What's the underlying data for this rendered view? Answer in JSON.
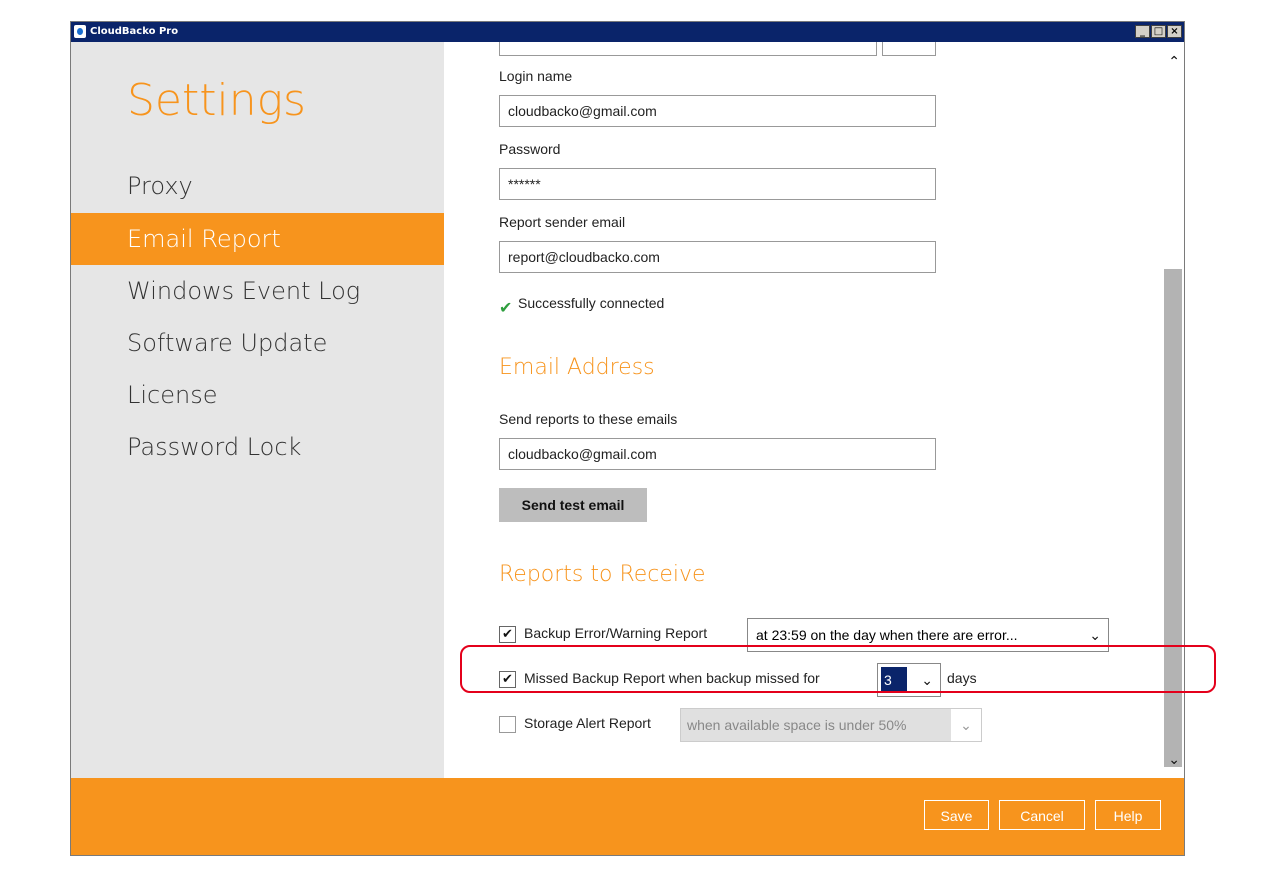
{
  "window": {
    "title": "CloudBacko Pro",
    "minimize": "_",
    "maximize": "□",
    "close": "×"
  },
  "sidebar": {
    "title": "Settings",
    "items": [
      {
        "label": "Proxy"
      },
      {
        "label": "Email Report",
        "active": true
      },
      {
        "label": "Windows Event Log"
      },
      {
        "label": "Software Update"
      },
      {
        "label": "License"
      },
      {
        "label": "Password Lock"
      }
    ]
  },
  "smtp": {
    "login_label": "Login name",
    "login_value": "cloudbacko@gmail.com",
    "password_label": "Password",
    "password_value": "******",
    "sender_label": "Report sender email",
    "sender_value": "report@cloudbacko.com",
    "status": "Successfully connected"
  },
  "email_address": {
    "title": "Email Address",
    "recipients_label": "Send reports to these emails",
    "recipients_value": "cloudbacko@gmail.com",
    "send_test_button": "Send test email"
  },
  "reports": {
    "title": "Reports to Receive",
    "backup_error": {
      "checked": true,
      "label": "Backup Error/Warning Report",
      "selected": "at 23:59 on the day when there are error..."
    },
    "missed_backup": {
      "checked": true,
      "label": "Missed Backup Report when backup missed for",
      "selected": "3",
      "suffix": "days"
    },
    "storage_alert": {
      "checked": false,
      "label": "Storage Alert Report",
      "selected": "when available space is under 50%"
    }
  },
  "footer": {
    "save": "Save",
    "cancel": "Cancel",
    "help": "Help"
  },
  "colors": {
    "accent": "#f7941d",
    "sidebar_bg": "#e6e6e6",
    "highlight": "#e4001b",
    "titlebar": "#0a246a",
    "success": "#2e9e3e"
  }
}
